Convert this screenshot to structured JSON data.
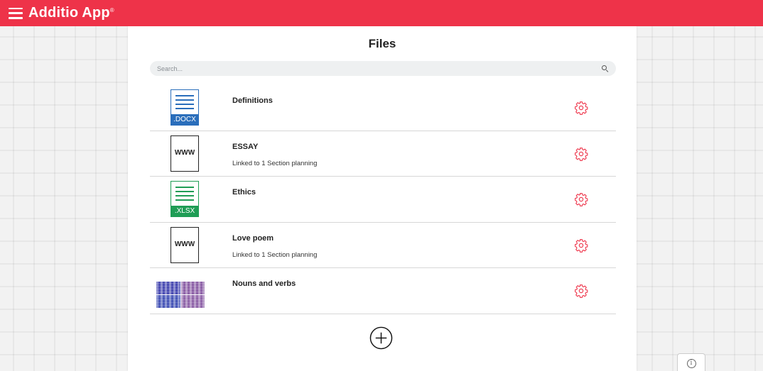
{
  "app": {
    "title": "Additio App",
    "trademark": "®"
  },
  "topbar": {
    "menu_icon": "hamburger-menu-icon"
  },
  "panel": {
    "title": "Files"
  },
  "search": {
    "placeholder": "Search...",
    "icon": "search-icon"
  },
  "files": [
    {
      "name": "Definitions",
      "subtitle": "",
      "type": "docx",
      "ext_label": ".DOCX"
    },
    {
      "name": "ESSAY",
      "subtitle": "Linked to 1 Section planning",
      "type": "link",
      "ext_label": "WWW"
    },
    {
      "name": "Ethics",
      "subtitle": "",
      "type": "xlsx",
      "ext_label": ".XLSX"
    },
    {
      "name": "Love poem",
      "subtitle": "Linked to 1 Section planning",
      "type": "link",
      "ext_label": "WWW"
    },
    {
      "name": "Nouns and verbs",
      "subtitle": "",
      "type": "image",
      "ext_label": ""
    }
  ],
  "actions": {
    "add_icon": "add-circle-icon",
    "settings_icon": "gear-icon",
    "info_icon": "info-icon",
    "info_label": "i"
  },
  "colors": {
    "brand": "#ee3349",
    "docx": "#2a6ebb",
    "xlsx": "#1f9d55",
    "gear": "#ee3349"
  }
}
